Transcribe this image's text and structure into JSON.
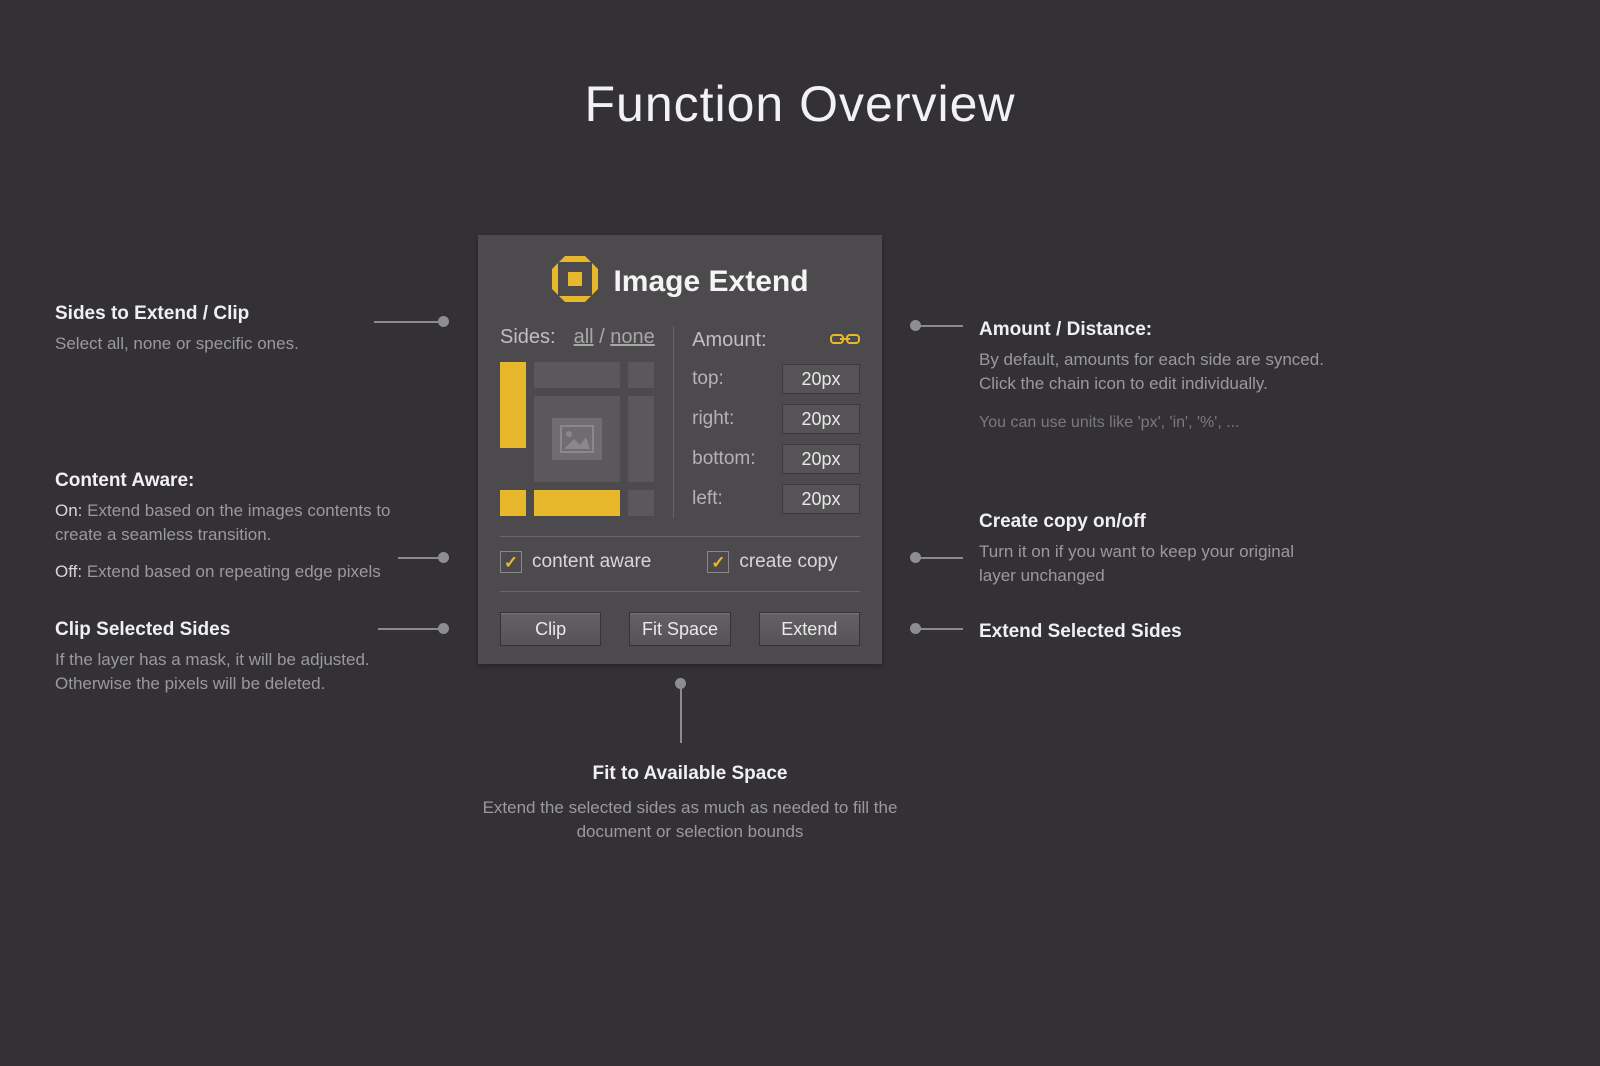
{
  "page_title": "Function Overview",
  "panel": {
    "title": "Image Extend",
    "sides_label": "Sides:",
    "link_all": "all",
    "link_none": "none",
    "amount_label": "Amount:",
    "rows": {
      "top": {
        "label": "top:",
        "value": "20px"
      },
      "right": {
        "label": "right:",
        "value": "20px"
      },
      "bottom": {
        "label": "bottom:",
        "value": "20px"
      },
      "left": {
        "label": "left:",
        "value": "20px"
      }
    },
    "content_aware_label": "content aware",
    "create_copy_label": "create copy",
    "btn_clip": "Clip",
    "btn_fit": "Fit Space",
    "btn_extend": "Extend"
  },
  "annotations": {
    "sides": {
      "title": "Sides to Extend / Clip",
      "desc": "Select all, none or specific ones."
    },
    "content_aware": {
      "title": "Content Aware:",
      "on_prefix": "On:",
      "on_desc": " Extend based on the images contents to create a seamless transition.",
      "off_prefix": "Off:",
      "off_desc": " Extend based on repeating edge pixels"
    },
    "clip": {
      "title": "Clip Selected Sides",
      "desc": "If the layer has a mask, it will be adjusted. Otherwise the pixels will be deleted."
    },
    "amount": {
      "title": "Amount / Distance:",
      "desc": "By default, amounts for each side are synced. Click the chain icon to edit individually.",
      "hint": "You can use units like 'px', 'in', '%', ..."
    },
    "create_copy": {
      "title": "Create copy on/off",
      "desc": "Turn it on if you want to keep your original layer unchanged"
    },
    "extend": {
      "title": "Extend Selected Sides"
    },
    "fit": {
      "title": "Fit to Available Space",
      "desc": "Extend the selected sides as much as needed to fill the document or selection bounds"
    }
  }
}
